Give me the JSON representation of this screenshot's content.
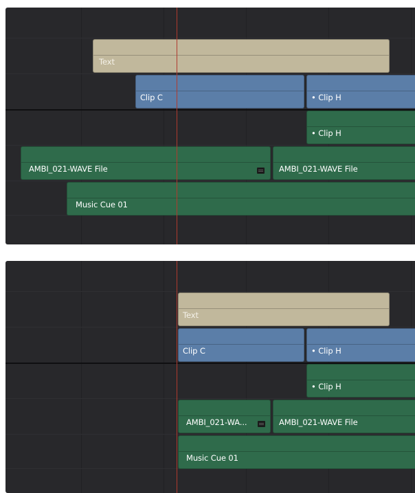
{
  "top": {
    "clips": {
      "text": "Text",
      "clip_c": "Clip C",
      "clip_h_video": "• Clip H",
      "clip_h_audio": "• Clip H",
      "ambi_left": "AMBI_021-WAVE File",
      "ambi_right": "AMBI_021-WAVE File",
      "music": "Music Cue 01"
    }
  },
  "bottom": {
    "clips": {
      "text": "Text",
      "clip_c": "Clip C",
      "clip_h_video": "• Clip H",
      "clip_h_audio": "• Clip H",
      "ambi_left": "AMBI_021-WA...",
      "ambi_right": "AMBI_021-WAVE File",
      "music": "Music Cue 01"
    }
  },
  "colors": {
    "panel_bg": "#28282b",
    "text_clip": "#c1b89c",
    "video_clip": "#5b7ea8",
    "audio_clip": "#2f6b4b",
    "playhead": "#b03a2e"
  },
  "icons": {
    "clip_marker": "clip-marker-icon"
  }
}
